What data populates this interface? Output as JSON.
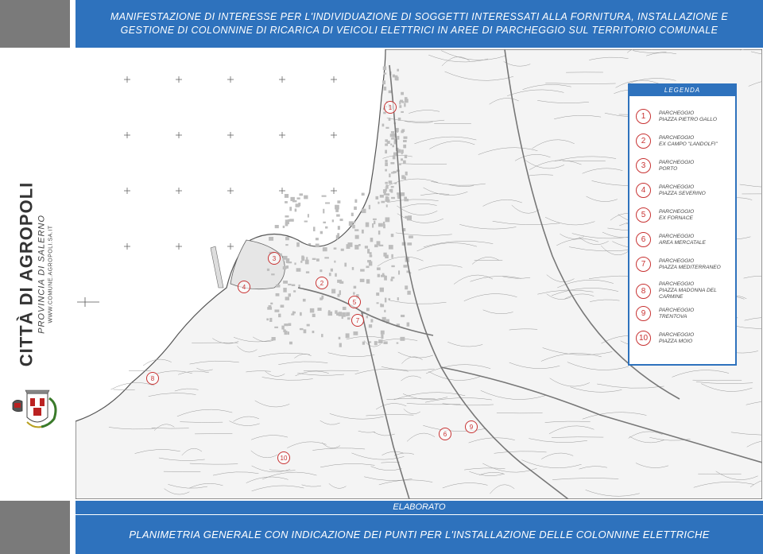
{
  "header": {
    "title": "MANIFESTAZIONE DI INTERESSE PER L'INDIVIDUAZIONE DI SOGGETTI INTERESSATI ALLA FORNITURA, INSTALLAZIONE E GESTIONE DI COLONNINE DI RICARICA DI VEICOLI ELETTRICI IN AREE DI PARCHEGGIO SUL TERRITORIO COMUNALE"
  },
  "sidebar": {
    "city": "CITTÀ DI AGROPOLI",
    "province": "PROVINCIA DI SALERNO",
    "website": "WWW.COMUNE.AGROPOLI.SA.IT"
  },
  "legend": {
    "title": "LEGENDA",
    "items": [
      {
        "num": "1",
        "line1": "PARCHEGGIO",
        "line2": "PIAZZA PIETRO GALLO"
      },
      {
        "num": "2",
        "line1": "PARCHEGGIO",
        "line2": "EX CAMPO \"LANDOLFI\""
      },
      {
        "num": "3",
        "line1": "PARCHEGGIO",
        "line2": "PORTO"
      },
      {
        "num": "4",
        "line1": "PARCHEGGIO",
        "line2": "PIAZZA SEVERINO"
      },
      {
        "num": "5",
        "line1": "PARCHEGGIO",
        "line2": "EX FORNACE"
      },
      {
        "num": "6",
        "line1": "PARCHEGGIO",
        "line2": "AREA MERCATALE"
      },
      {
        "num": "7",
        "line1": "PARCHEGGIO",
        "line2": "PIAZZA MEDITERRANEO"
      },
      {
        "num": "8",
        "line1": "PARCHEGGIO",
        "line2": "PIAZZA MADONNA DEL CARMINE"
      },
      {
        "num": "9",
        "line1": "PARCHEGGIO",
        "line2": "TRENTOVA"
      },
      {
        "num": "10",
        "line1": "PARCHEGGIO",
        "line2": "PIAZZA MOIO"
      }
    ]
  },
  "map_markers": [
    "1",
    "2",
    "3",
    "4",
    "5",
    "6",
    "7",
    "8",
    "9",
    "10"
  ],
  "footer": {
    "label": "ELABORATO",
    "caption": "PLANIMETRIA GENERALE CON INDICAZIONE DEI PUNTI PER L'INSTALLAZIONE DELLE COLONNINE ELETTRICHE"
  },
  "colors": {
    "brand_blue": "#2e72bd",
    "marker_red": "#c83232",
    "sidebar_gray": "#7a7a7a"
  }
}
